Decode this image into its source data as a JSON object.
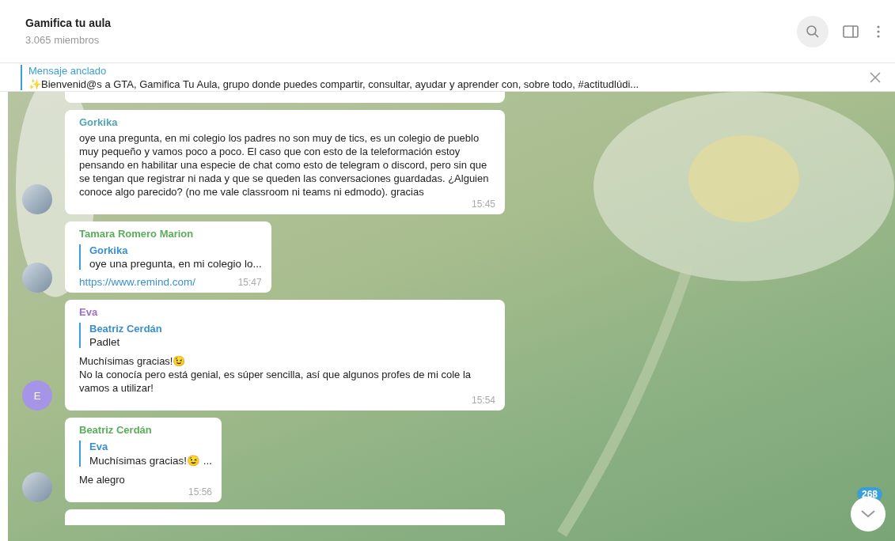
{
  "header": {
    "title": "Gamifica tu aula",
    "subtitle": "3.065 miembros"
  },
  "pinned": {
    "label": "Mensaje anclado",
    "text": "✨Bienvenid@s a GTA, Gamifica Tu Aula, grupo donde puedes compartir, consultar, ayudar y aprender con, sobre todo, #actitudlúdi..."
  },
  "messages": [
    {
      "sender": "Gorkika",
      "color": "#4fa6b8",
      "avatar": {
        "kind": "photo"
      },
      "text": "oye una pregunta, en mi colegio los padres no son muy de tics, es un colegio de pueblo muy pequeño y vamos poco a poco. El caso que con esto de la teleformación estoy pensando en habilitar una especie de chat como esto de telegram o discord, pero sin que se tengan que registrar ni nada y que se queden las conversaciones guardadas. ¿Alguien conoce algo parecido? (no me vale classroom ni teams ni edmodo). gracias",
      "time": "15:45"
    },
    {
      "sender": "Tamara Romero Marion",
      "color": "#5aae5a",
      "avatar": {
        "kind": "photo"
      },
      "reply": {
        "author": "Gorkika",
        "text": "oye una pregunta, en mi colegio lo..."
      },
      "link": "https://www.remind.com/",
      "time": "15:47"
    },
    {
      "sender": "Eva",
      "color": "#9a6fd0",
      "avatar": {
        "kind": "initial",
        "initial": "E",
        "color": "#a695e7"
      },
      "reply": {
        "author": "Beatriz Cerdán",
        "text": "Padlet"
      },
      "text": "Muchísimas gracias!😉\nNo la conocía pero está genial, es súper sencilla, así que algunos profes de mi cole la vamos a utilizar!",
      "time": "15:54"
    },
    {
      "sender": "Beatriz Cerdán",
      "color": "#5aae5a",
      "avatar": {
        "kind": "photo"
      },
      "reply": {
        "author": "Eva",
        "text": "Muchísimas gracias!😉 ..."
      },
      "text": "Me alegro",
      "time": "15:56"
    }
  ],
  "scroll_button": {
    "badge": "268"
  }
}
